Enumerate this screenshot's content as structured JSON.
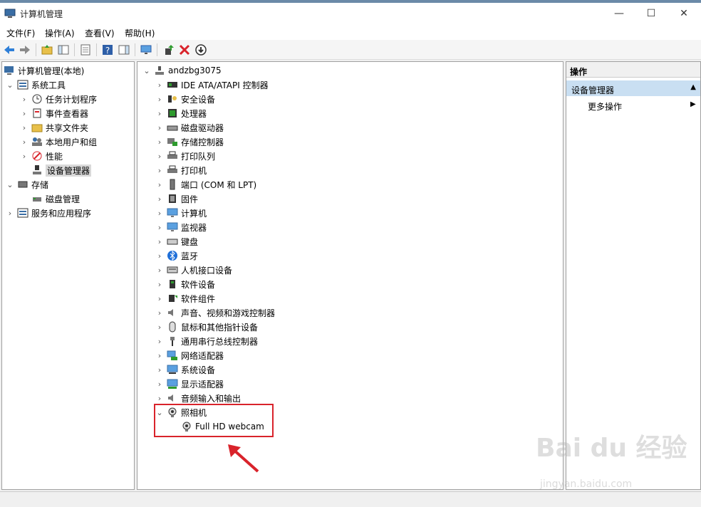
{
  "window": {
    "title": "计算机管理",
    "minimize": "—",
    "maximize": "☐",
    "close": "✕"
  },
  "menu": [
    "文件(F)",
    "操作(A)",
    "查看(V)",
    "帮助(H)"
  ],
  "toolbar": {
    "icons": [
      "back-arrow-icon",
      "forward-arrow-icon",
      "folder-up-icon",
      "show-tree-icon",
      "properties-icon",
      "help-icon",
      "action-pane-icon",
      "monitor-icon",
      "update-driver-icon",
      "uninstall-icon",
      "disable-icon"
    ]
  },
  "left_tree": {
    "root": "计算机管理(本地)",
    "items": [
      {
        "label": "系统工具",
        "indent": 1,
        "expanded": true
      },
      {
        "label": "任务计划程序",
        "indent": 2
      },
      {
        "label": "事件查看器",
        "indent": 2
      },
      {
        "label": "共享文件夹",
        "indent": 2
      },
      {
        "label": "本地用户和组",
        "indent": 2
      },
      {
        "label": "性能",
        "indent": 2
      },
      {
        "label": "设备管理器",
        "indent": 2,
        "selected": true
      },
      {
        "label": "存储",
        "indent": 1,
        "expanded": true
      },
      {
        "label": "磁盘管理",
        "indent": 2
      },
      {
        "label": "服务和应用程序",
        "indent": 1
      }
    ]
  },
  "device_tree": {
    "computer": "andzbg3075",
    "categories": [
      "IDE ATA/ATAPI 控制器",
      "安全设备",
      "处理器",
      "磁盘驱动器",
      "存储控制器",
      "打印队列",
      "打印机",
      "端口 (COM 和 LPT)",
      "固件",
      "计算机",
      "监视器",
      "键盘",
      "蓝牙",
      "人机接口设备",
      "软件设备",
      "软件组件",
      "声音、视频和游戏控制器",
      "鼠标和其他指针设备",
      "通用串行总线控制器",
      "网络适配器",
      "系统设备",
      "显示适配器",
      "音频输入和输出",
      "照相机"
    ],
    "expanded_child": "Full HD webcam"
  },
  "actions": {
    "header": "操作",
    "section": "设备管理器",
    "more": "更多操作"
  },
  "watermark": {
    "logo": "Bai du 经验",
    "url": "jingyan.baidu.com"
  },
  "colors": {
    "highlight": "#d9232b",
    "selection": "#d9d9d9",
    "section_bg": "#c9dff2"
  }
}
